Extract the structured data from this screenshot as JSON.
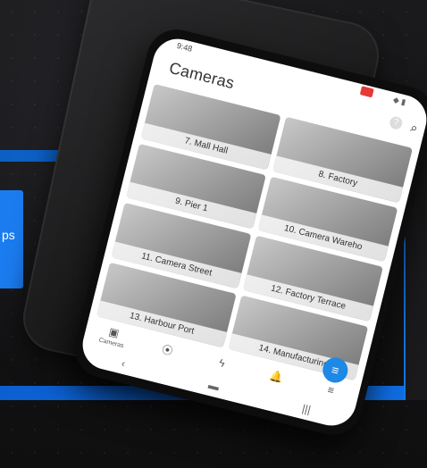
{
  "left_chip": {
    "text": "ps"
  },
  "app": {
    "status_time": "9:48",
    "status_icons": "◆ ▮",
    "title": "Cameras",
    "help_icon": "?",
    "search_icon": "search-icon"
  },
  "cameras": [
    {
      "label": "7. Mall Hall"
    },
    {
      "label": "8. Factory"
    },
    {
      "label": "9. Pier 1"
    },
    {
      "label": "10. Camera Wareho"
    },
    {
      "label": "11. Camera Street"
    },
    {
      "label": "12. Factory Terrace"
    },
    {
      "label": "13. Harbour Port"
    },
    {
      "label": "14. Manufacturing"
    }
  ],
  "bottom_nav": [
    {
      "icon": "camera-icon",
      "glyph": "▣",
      "label": "Cameras"
    },
    {
      "icon": "location-icon",
      "glyph": "⦿",
      "label": ""
    },
    {
      "icon": "bolt-icon",
      "glyph": "ϟ",
      "label": ""
    },
    {
      "icon": "bell-icon",
      "glyph": "🔔",
      "label": ""
    },
    {
      "icon": "menu-icon",
      "glyph": "≡",
      "label": ""
    }
  ],
  "fab": {
    "icon": "filter-icon",
    "glyph": "≡"
  },
  "system_nav": [
    {
      "icon": "back-icon",
      "glyph": "‹"
    },
    {
      "icon": "home-icon",
      "glyph": "▬"
    },
    {
      "icon": "recents-icon",
      "glyph": "|||"
    }
  ]
}
